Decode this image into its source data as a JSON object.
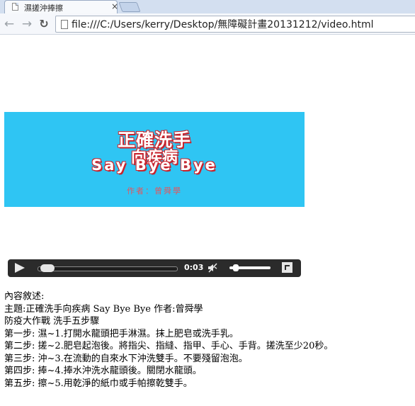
{
  "browser": {
    "tab": {
      "title": "濕搓沖捧擦"
    },
    "address": "file:///C:/Users/kerry/Desktop/無障礙計畫20131212/video.html"
  },
  "video": {
    "poster": {
      "line1": "正確洗手",
      "line2": "向疾病",
      "line3": "Say Bye Bye",
      "author": "作者：曾舜學"
    },
    "current_time": "0:03",
    "progress_fraction": 0.02,
    "volume_fraction": 0.1
  },
  "description": {
    "lines": [
      "內容敘述:",
      "主題:正確洗手向疾病 Say Bye Bye 作者:曾舜學",
      "防疫大作戰 洗手五步驟",
      "第一步: 濕~1.打開水龍頭把手淋濕。抹上肥皂或洗手乳。",
      "第二步: 搓~2.肥皂起泡後。將指尖、指縫、指甲、手心、手背。搓洗至少20秒。",
      "第三步: 沖~3.在流動的自來水下沖洗雙手。不要殘留泡泡。",
      "第四步: 捧~4.捧水沖洗水龍頭後。關閉水龍頭。",
      "第五步: 擦~5.用乾淨的紙巾或手帕擦乾雙手。"
    ]
  }
}
